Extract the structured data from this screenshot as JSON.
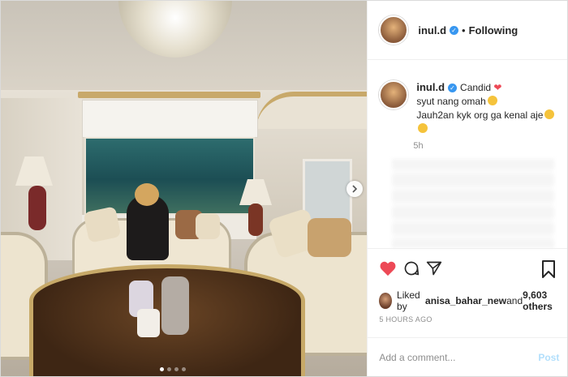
{
  "header": {
    "username": "inul.d",
    "separator": "•",
    "follow_status": "Following"
  },
  "caption": {
    "username": "inul.d",
    "line1": "Candid",
    "line2": "syut nang omah",
    "line3": "Jauh2an kyk org ga kenal aje",
    "time": "5h"
  },
  "likes": {
    "prefix": "Liked by ",
    "user": "anisa_bahar_new",
    "middle": " and ",
    "count": "9,603 others"
  },
  "timestamp": "5 HOURS AGO",
  "comment": {
    "placeholder": "Add a comment...",
    "post_label": "Post"
  },
  "carousel": {
    "total": 4,
    "active": 1
  },
  "icons": {
    "verified": "verified-badge-icon",
    "like": "heart-icon",
    "comment": "comment-icon",
    "share": "share-icon",
    "save": "bookmark-icon",
    "next": "chevron-right-icon",
    "caption_heart": "heart-emoji",
    "caption_face1": "face-emoji",
    "caption_face2": "laughing-emoji"
  },
  "colors": {
    "like_red": "#ed4956",
    "verified_blue": "#3897f0",
    "post_disabled": "#b2dffc",
    "text": "#262626",
    "muted": "#8e8e8e"
  }
}
